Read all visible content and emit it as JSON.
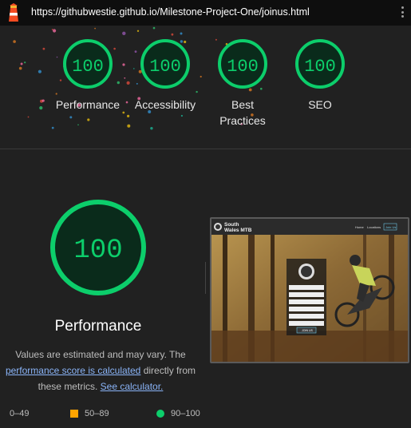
{
  "browser": {
    "url": "https://githubwestie.github.io/Milestone-Project-One/joinus.html"
  },
  "summary": {
    "gauges": [
      {
        "score": "100",
        "label": "Performance"
      },
      {
        "score": "100",
        "label": "Accessibility"
      },
      {
        "score": "100",
        "label": "Best Practices"
      },
      {
        "score": "100",
        "label": "SEO"
      }
    ]
  },
  "performance": {
    "score": "100",
    "title": "Performance",
    "desc_part1": "Values are estimated and may vary. The ",
    "desc_link1": "performance score is calculated",
    "desc_part2": " directly from these metrics. ",
    "desc_link2": "See calculator."
  },
  "screenshot": {
    "brand_line1": "South",
    "brand_line2": "Wales MTB",
    "nav_home": "Home",
    "nav_locations": "Locations",
    "nav_join": "Join Us",
    "form_button": "JOIN US"
  },
  "legend": {
    "fail": "0–49",
    "average": "50–89",
    "pass": "90–100"
  },
  "colors": {
    "pass": "#0cce6b",
    "average": "#ffa400",
    "link": "#8ab4f8"
  }
}
